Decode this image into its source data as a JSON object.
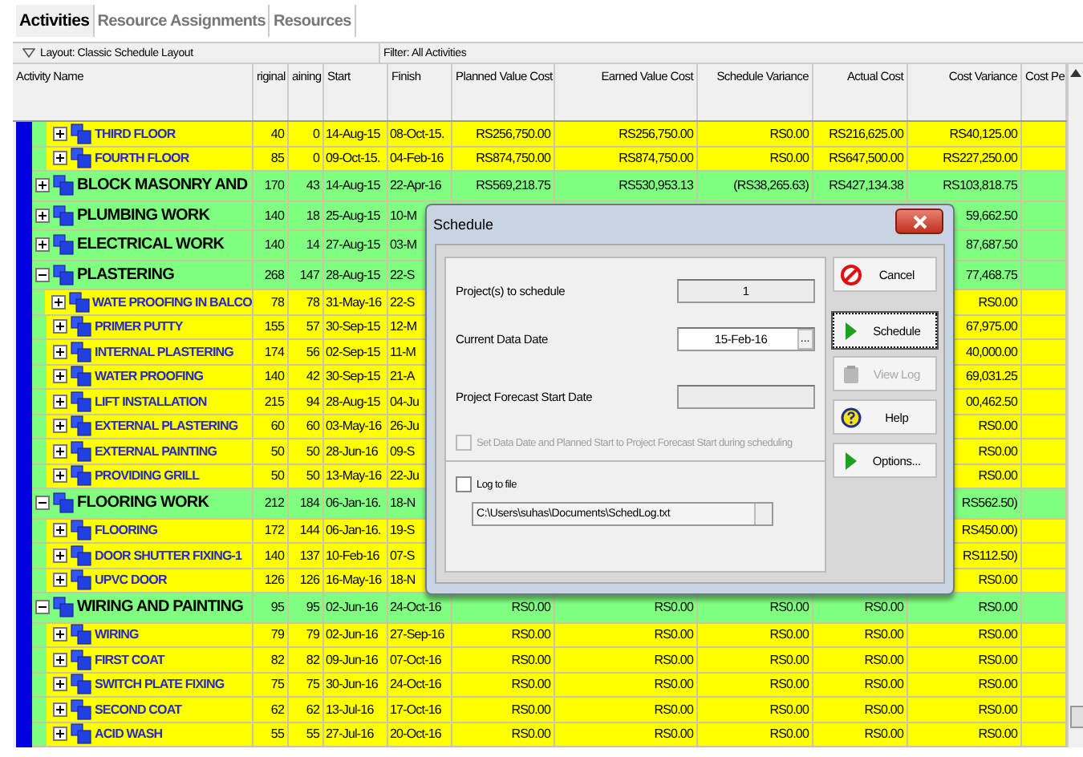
{
  "tabs": [
    {
      "label": "Activities",
      "selected": true
    },
    {
      "label": "Resource Assignments",
      "selected": false
    },
    {
      "label": "Resources",
      "selected": false
    }
  ],
  "layout_bar": {
    "layout": "Layout: Classic Schedule Layout",
    "filter": "Filter: All Activities"
  },
  "table": {
    "columns": [
      "Activity Name",
      "riginal",
      "aining",
      "Start",
      "Finish",
      "Planned Value Cost",
      "Earned Value Cost",
      "Schedule Variance",
      "Actual Cost",
      "Cost Variance",
      "Cost Pe"
    ],
    "rows": [
      {
        "kind": "activity",
        "name": "THIRD FLOOR",
        "expanded": false,
        "original": "40",
        "remaining": "0",
        "start": "14-Aug-15",
        "finish": "08-Oct-15.",
        "planned_value_cost": "RS256,750.00",
        "earned_value_cost": "RS256,750.00",
        "schedule_variance": "RS0.00",
        "actual_cost": "RS216,625.00",
        "cost_variance": "RS40,125.00"
      },
      {
        "kind": "activity",
        "name": "FOURTH FLOOR",
        "expanded": false,
        "original": "85",
        "remaining": "0",
        "start": "09-Oct-15.",
        "finish": "04-Feb-16",
        "planned_value_cost": "RS874,750.00",
        "earned_value_cost": "RS874,750.00",
        "schedule_variance": "RS0.00",
        "actual_cost": "RS647,500.00",
        "cost_variance": "RS227,250.00"
      },
      {
        "kind": "wbs",
        "name": "BLOCK MASONRY AND",
        "expanded": false,
        "original": "170",
        "remaining": "43",
        "start": "14-Aug-15",
        "finish": "22-Apr-16",
        "planned_value_cost": "RS569,218.75",
        "earned_value_cost": "RS530,953.13",
        "schedule_variance": "(RS38,265.63)",
        "actual_cost": "RS427,134.38",
        "cost_variance": "RS103,818.75"
      },
      {
        "kind": "wbs",
        "name": "PLUMBING WORK",
        "expanded": false,
        "original": "140",
        "remaining": "18",
        "start": "25-Aug-15",
        "finish": "10-M",
        "cost_variance": "59,662.50"
      },
      {
        "kind": "wbs",
        "name": "ELECTRICAL WORK",
        "expanded": false,
        "original": "140",
        "remaining": "14",
        "start": "27-Aug-15",
        "finish": "03-M",
        "cost_variance": "87,687.50"
      },
      {
        "kind": "wbs",
        "name": "PLASTERING",
        "expanded": true,
        "original": "268",
        "remaining": "147",
        "start": "28-Aug-15",
        "finish": "22-S",
        "cost_variance": "77,468.75",
        "children": [
          {
            "kind": "activity",
            "name": "WATE PROOFING IN BALCO",
            "expanded": false,
            "original": "78",
            "remaining": "78",
            "start": "31-May-16",
            "finish": "22-S",
            "cost_variance": "RS0.00"
          },
          {
            "kind": "activity",
            "name": "PRIMER PUTTY",
            "expanded": false,
            "original": "155",
            "remaining": "57",
            "start": "30-Sep-15",
            "finish": "12-M",
            "cost_variance": "67,975.00"
          },
          {
            "kind": "activity",
            "name": "INTERNAL PLASTERING",
            "expanded": false,
            "original": "174",
            "remaining": "56",
            "start": "02-Sep-15",
            "finish": "11-M",
            "cost_variance": "40,000.00"
          },
          {
            "kind": "activity",
            "name": "WATER PROOFING",
            "expanded": false,
            "original": "140",
            "remaining": "42",
            "start": "30-Sep-15",
            "finish": "21-A",
            "cost_variance": "69,031.25"
          },
          {
            "kind": "activity",
            "name": "LIFT INSTALLATION",
            "expanded": false,
            "original": "215",
            "remaining": "94",
            "start": "28-Aug-15",
            "finish": "04-Ju",
            "cost_variance": "00,462.50"
          },
          {
            "kind": "activity",
            "name": "EXTERNAL PLASTERING",
            "expanded": false,
            "original": "60",
            "remaining": "60",
            "start": "03-May-16",
            "finish": "26-Ju",
            "cost_variance": "RS0.00"
          },
          {
            "kind": "activity",
            "name": "EXTERNAL PAINTING",
            "expanded": false,
            "original": "50",
            "remaining": "50",
            "start": "28-Jun-16",
            "finish": "09-S",
            "cost_variance": "RS0.00"
          },
          {
            "kind": "activity",
            "name": "PROVIDING GRILL",
            "expanded": false,
            "original": "50",
            "remaining": "50",
            "start": "13-May-16",
            "finish": "22-Ju",
            "cost_variance": "RS0.00"
          }
        ]
      },
      {
        "kind": "wbs",
        "name": "FLOORING WORK",
        "expanded": true,
        "original": "212",
        "remaining": "184",
        "start": "06-Jan-16.",
        "finish": "18-N",
        "cost_variance": "RS562.50)",
        "children": [
          {
            "kind": "activity",
            "name": "FLOORING",
            "expanded": false,
            "original": "172",
            "remaining": "144",
            "start": "06-Jan-16.",
            "finish": "19-S",
            "cost_variance": "RS450.00)"
          },
          {
            "kind": "activity",
            "name": "DOOR SHUTTER FIXING-1",
            "expanded": false,
            "original": "140",
            "remaining": "137",
            "start": "10-Feb-16",
            "finish": "07-S",
            "cost_variance": "RS112.50)"
          },
          {
            "kind": "activity",
            "name": "UPVC DOOR",
            "expanded": false,
            "original": "126",
            "remaining": "126",
            "start": "16-May-16",
            "finish": "18-N",
            "cost_variance": "RS0.00"
          }
        ]
      },
      {
        "kind": "wbs",
        "name": "WIRING AND PAINTING",
        "expanded": true,
        "original": "95",
        "remaining": "95",
        "start": "02-Jun-16",
        "finish": "24-Oct-16",
        "planned_value_cost": "RS0.00",
        "earned_value_cost": "RS0.00",
        "schedule_variance": "RS0.00",
        "actual_cost": "RS0.00",
        "cost_variance": "RS0.00",
        "children": [
          {
            "kind": "activity",
            "name": "WIRING",
            "expanded": false,
            "original": "79",
            "remaining": "79",
            "start": "02-Jun-16",
            "finish": "27-Sep-16",
            "planned_value_cost": "RS0.00",
            "earned_value_cost": "RS0.00",
            "schedule_variance": "RS0.00",
            "actual_cost": "RS0.00",
            "cost_variance": "RS0.00"
          },
          {
            "kind": "activity",
            "name": "FIRST COAT",
            "expanded": false,
            "original": "82",
            "remaining": "82",
            "start": "09-Jun-16",
            "finish": "07-Oct-16",
            "planned_value_cost": "RS0.00",
            "earned_value_cost": "RS0.00",
            "schedule_variance": "RS0.00",
            "actual_cost": "RS0.00",
            "cost_variance": "RS0.00"
          },
          {
            "kind": "activity",
            "name": "SWITCH PLATE FIXING",
            "expanded": false,
            "original": "75",
            "remaining": "75",
            "start": "30-Jun-16",
            "finish": "24-Oct-16",
            "planned_value_cost": "RS0.00",
            "earned_value_cost": "RS0.00",
            "schedule_variance": "RS0.00",
            "actual_cost": "RS0.00",
            "cost_variance": "RS0.00"
          },
          {
            "kind": "activity",
            "name": "SECOND COAT",
            "expanded": false,
            "original": "62",
            "remaining": "62",
            "start": "13-Jul-16",
            "finish": "17-Oct-16",
            "planned_value_cost": "RS0.00",
            "earned_value_cost": "RS0.00",
            "schedule_variance": "RS0.00",
            "actual_cost": "RS0.00",
            "cost_variance": "RS0.00"
          },
          {
            "kind": "activity",
            "name": "ACID WASH",
            "expanded": false,
            "original": "55",
            "remaining": "55",
            "start": "27-Jul-16",
            "finish": "20-Oct-16",
            "planned_value_cost": "RS0.00",
            "earned_value_cost": "RS0.00",
            "schedule_variance": "RS0.00",
            "actual_cost": "RS0.00",
            "cost_variance": "RS0.00"
          }
        ]
      }
    ]
  },
  "dialog": {
    "title": "Schedule",
    "fields": [
      {
        "label": "Project(s) to schedule",
        "kind": "readonly",
        "value": "1"
      },
      {
        "label": "Current Data Date",
        "kind": "date",
        "value": "15-Feb-16",
        "button": "..."
      },
      {
        "label": "Project Forecast Start Date",
        "kind": "readonly"
      }
    ],
    "set_data_date": {
      "label": "Set Data Date and Planned Start to Project Forecast Start during scheduling",
      "checked": false,
      "disabled": true
    },
    "log_to_file": {
      "label": "Log to file",
      "checked": false,
      "path": "C:\\Users\\suhas\\Documents\\SchedLog.txt"
    },
    "buttons": [
      {
        "label": "Cancel",
        "kind": "cancel",
        "disabled": false,
        "focused": false
      },
      {
        "label": "Schedule",
        "kind": "run",
        "disabled": false,
        "focused": true
      },
      {
        "label": "View Log",
        "kind": "log",
        "disabled": true,
        "focused": false
      },
      {
        "label": "Help",
        "kind": "help",
        "disabled": false,
        "focused": false
      },
      {
        "label": "Options...",
        "kind": "run",
        "disabled": false,
        "focused": false
      }
    ]
  }
}
